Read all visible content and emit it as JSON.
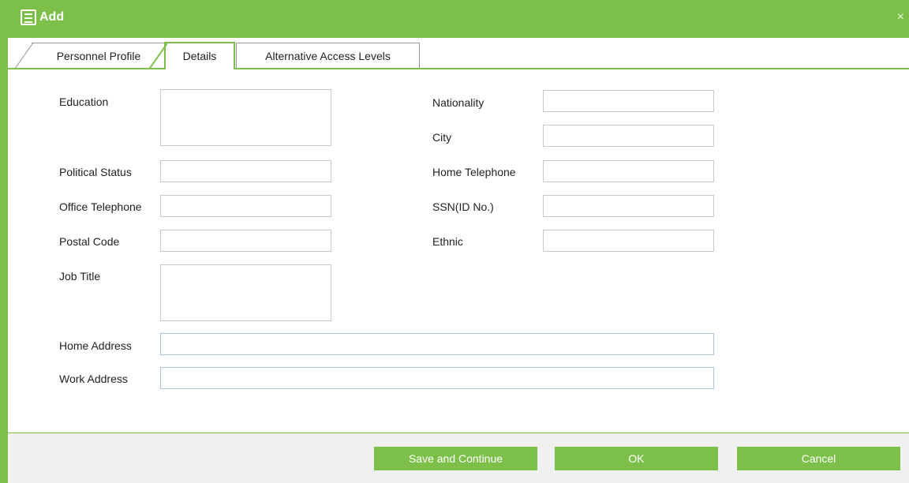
{
  "window": {
    "title": "Add",
    "close_glyph": "×",
    "icon": "form-icon"
  },
  "tabs": [
    {
      "label": "Personnel Profile",
      "active": false
    },
    {
      "label": "Details",
      "active": true
    },
    {
      "label": "Alternative Access Levels",
      "active": false
    }
  ],
  "fields": {
    "education": {
      "label": "Education",
      "value": ""
    },
    "political_status": {
      "label": "Political Status",
      "value": ""
    },
    "office_telephone": {
      "label": "Office Telephone",
      "value": ""
    },
    "postal_code": {
      "label": "Postal Code",
      "value": ""
    },
    "job_title": {
      "label": "Job Title",
      "value": ""
    },
    "nationality": {
      "label": "Nationality",
      "value": ""
    },
    "city": {
      "label": "City",
      "value": ""
    },
    "home_telephone": {
      "label": "Home Telephone",
      "value": ""
    },
    "ssn": {
      "label": "SSN(ID No.)",
      "value": ""
    },
    "ethnic": {
      "label": "Ethnic",
      "value": ""
    },
    "home_address": {
      "label": "Home Address",
      "value": ""
    },
    "work_address": {
      "label": "Work Address",
      "value": ""
    }
  },
  "buttons": {
    "save_continue": "Save and Continue",
    "ok": "OK",
    "cancel": "Cancel"
  },
  "colors": {
    "accent": "#7cc04a",
    "footer_bg": "#f0f0f0"
  }
}
